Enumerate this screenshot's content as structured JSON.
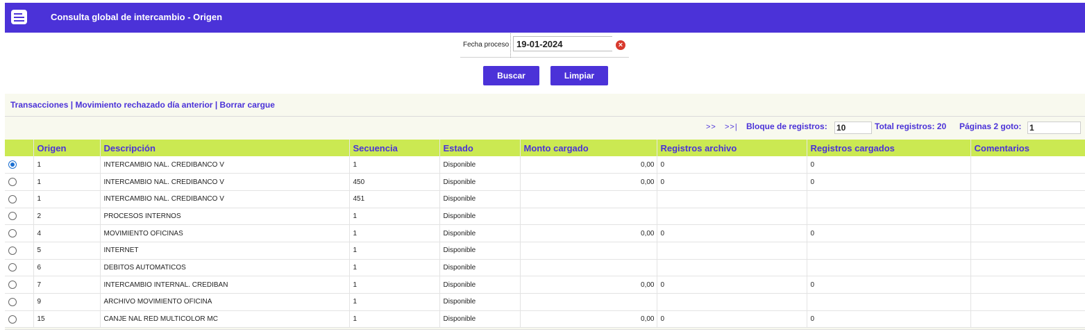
{
  "header": {
    "title": "Consulta global de intercambio - Origen",
    "icon": "list-icon"
  },
  "filter": {
    "label": "Fecha proceso",
    "value": "19-01-2024"
  },
  "buttons": {
    "search": "Buscar",
    "clear": "Limpiar"
  },
  "links": {
    "transacciones": "Transacciones",
    "sep": "|",
    "rechazado": "Movimiento rechazado día anterior",
    "borrar": "Borrar cargue"
  },
  "pager": {
    "next": ">>",
    "last": ">>|",
    "block_label": "Bloque de registros:",
    "block_value": "10",
    "total_label": "Total registros: 20",
    "pages_label": "Páginas 2 goto:",
    "goto_value": "1"
  },
  "table": {
    "headers": [
      "Origen",
      "Descripción",
      "Secuencia",
      "Estado",
      "Monto cargado",
      "Registros archivo",
      "Registros cargados",
      "Comentarios"
    ],
    "rows": [
      {
        "selected": true,
        "origen": "1",
        "descripcion": "INTERCAMBIO NAL. CREDIBANCO V",
        "secuencia": "1",
        "estado": "Disponible",
        "monto": "0,00",
        "reg_archivo": "0",
        "reg_cargados": "0",
        "comentarios": ""
      },
      {
        "selected": false,
        "origen": "1",
        "descripcion": "INTERCAMBIO NAL. CREDIBANCO V",
        "secuencia": "450",
        "estado": "Disponible",
        "monto": "0,00",
        "reg_archivo": "0",
        "reg_cargados": "0",
        "comentarios": ""
      },
      {
        "selected": false,
        "origen": "1",
        "descripcion": "INTERCAMBIO NAL. CREDIBANCO V",
        "secuencia": "451",
        "estado": "Disponible",
        "monto": "",
        "reg_archivo": "",
        "reg_cargados": "",
        "comentarios": ""
      },
      {
        "selected": false,
        "origen": "2",
        "descripcion": "PROCESOS INTERNOS",
        "secuencia": "1",
        "estado": "Disponible",
        "monto": "",
        "reg_archivo": "",
        "reg_cargados": "",
        "comentarios": ""
      },
      {
        "selected": false,
        "origen": "4",
        "descripcion": "MOVIMIENTO OFICINAS",
        "secuencia": "1",
        "estado": "Disponible",
        "monto": "0,00",
        "reg_archivo": "0",
        "reg_cargados": "0",
        "comentarios": ""
      },
      {
        "selected": false,
        "origen": "5",
        "descripcion": "INTERNET",
        "secuencia": "1",
        "estado": "Disponible",
        "monto": "",
        "reg_archivo": "",
        "reg_cargados": "",
        "comentarios": ""
      },
      {
        "selected": false,
        "origen": "6",
        "descripcion": "DEBITOS AUTOMATICOS",
        "secuencia": "1",
        "estado": "Disponible",
        "monto": "",
        "reg_archivo": "",
        "reg_cargados": "",
        "comentarios": ""
      },
      {
        "selected": false,
        "origen": "7",
        "descripcion": "INTERCAMBIO INTERNAL. CREDIBAN",
        "secuencia": "1",
        "estado": "Disponible",
        "monto": "0,00",
        "reg_archivo": "0",
        "reg_cargados": "0",
        "comentarios": ""
      },
      {
        "selected": false,
        "origen": "9",
        "descripcion": "ARCHIVO MOVIMIENTO OFICINA",
        "secuencia": "1",
        "estado": "Disponible",
        "monto": "",
        "reg_archivo": "",
        "reg_cargados": "",
        "comentarios": ""
      },
      {
        "selected": false,
        "origen": "15",
        "descripcion": "CANJE NAL RED MULTICOLOR MC",
        "secuencia": "1",
        "estado": "Disponible",
        "monto": "0,00",
        "reg_archivo": "0",
        "reg_cargados": "0",
        "comentarios": ""
      }
    ]
  },
  "colors": {
    "brand": "#4b32d8",
    "header_bg": "#cbe952",
    "panel_bg": "#f8f9ee",
    "clear_icon": "#d83a2e"
  }
}
